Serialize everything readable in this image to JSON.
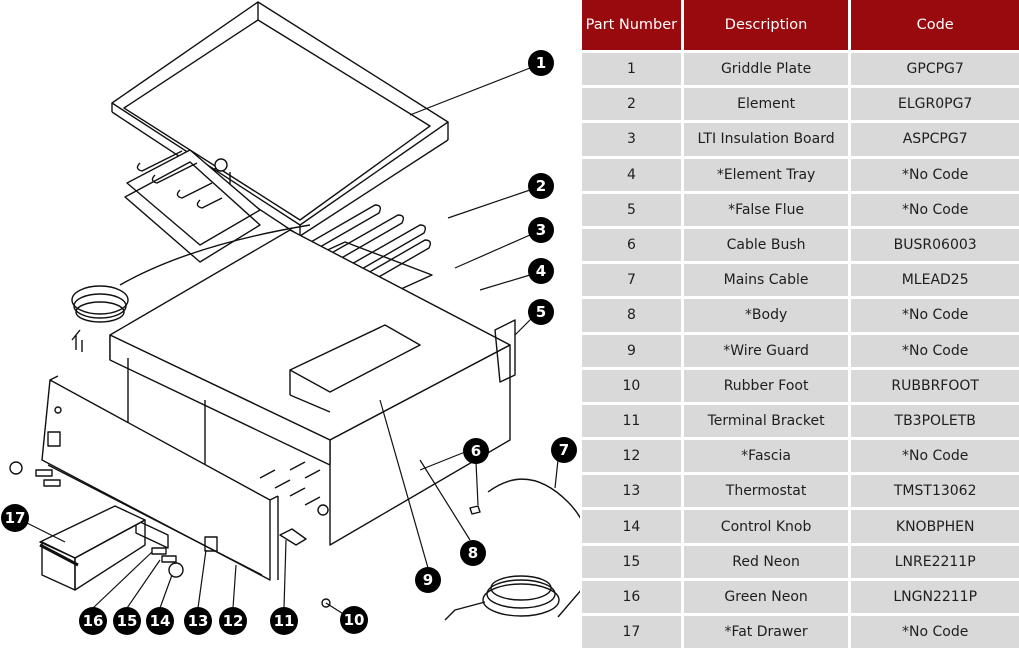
{
  "table": {
    "headers": {
      "part_number": "Part Number",
      "description": "Description",
      "code": "Code"
    },
    "header_color": "#980a0e",
    "row_color": "#d9d9d9",
    "rows": [
      {
        "part_number": "1",
        "description": "Griddle Plate",
        "code": "GPCPG7"
      },
      {
        "part_number": "2",
        "description": "Element",
        "code": "ELGR0PG7"
      },
      {
        "part_number": "3",
        "description": "LTI Insulation Board",
        "code": "ASPCPG7"
      },
      {
        "part_number": "4",
        "description": "*Element Tray",
        "code": "*No Code"
      },
      {
        "part_number": "5",
        "description": "*False Flue",
        "code": "*No Code"
      },
      {
        "part_number": "6",
        "description": "Cable Bush",
        "code": "BUSR06003"
      },
      {
        "part_number": "7",
        "description": "Mains Cable",
        "code": "MLEAD25"
      },
      {
        "part_number": "8",
        "description": "*Body",
        "code": "*No Code"
      },
      {
        "part_number": "9",
        "description": "*Wire Guard",
        "code": "*No Code"
      },
      {
        "part_number": "10",
        "description": "Rubber Foot",
        "code": "RUBBRFOOT"
      },
      {
        "part_number": "11",
        "description": "Terminal Bracket",
        "code": "TB3POLETB"
      },
      {
        "part_number": "12",
        "description": "*Fascia",
        "code": "*No Code"
      },
      {
        "part_number": "13",
        "description": "Thermostat",
        "code": "TMST13062"
      },
      {
        "part_number": "14",
        "description": "Control Knob",
        "code": "KNOBPHEN"
      },
      {
        "part_number": "15",
        "description": "Red Neon",
        "code": "LNRE2211P"
      },
      {
        "part_number": "16",
        "description": "Green Neon",
        "code": "LNGN2211P"
      },
      {
        "part_number": "17",
        "description": "*Fat Drawer",
        "code": "*No Code"
      }
    ]
  },
  "diagram": {
    "callouts": [
      "1",
      "2",
      "3",
      "4",
      "5",
      "6",
      "7",
      "8",
      "9",
      "10",
      "11",
      "12",
      "13",
      "14",
      "15",
      "16",
      "17"
    ]
  }
}
